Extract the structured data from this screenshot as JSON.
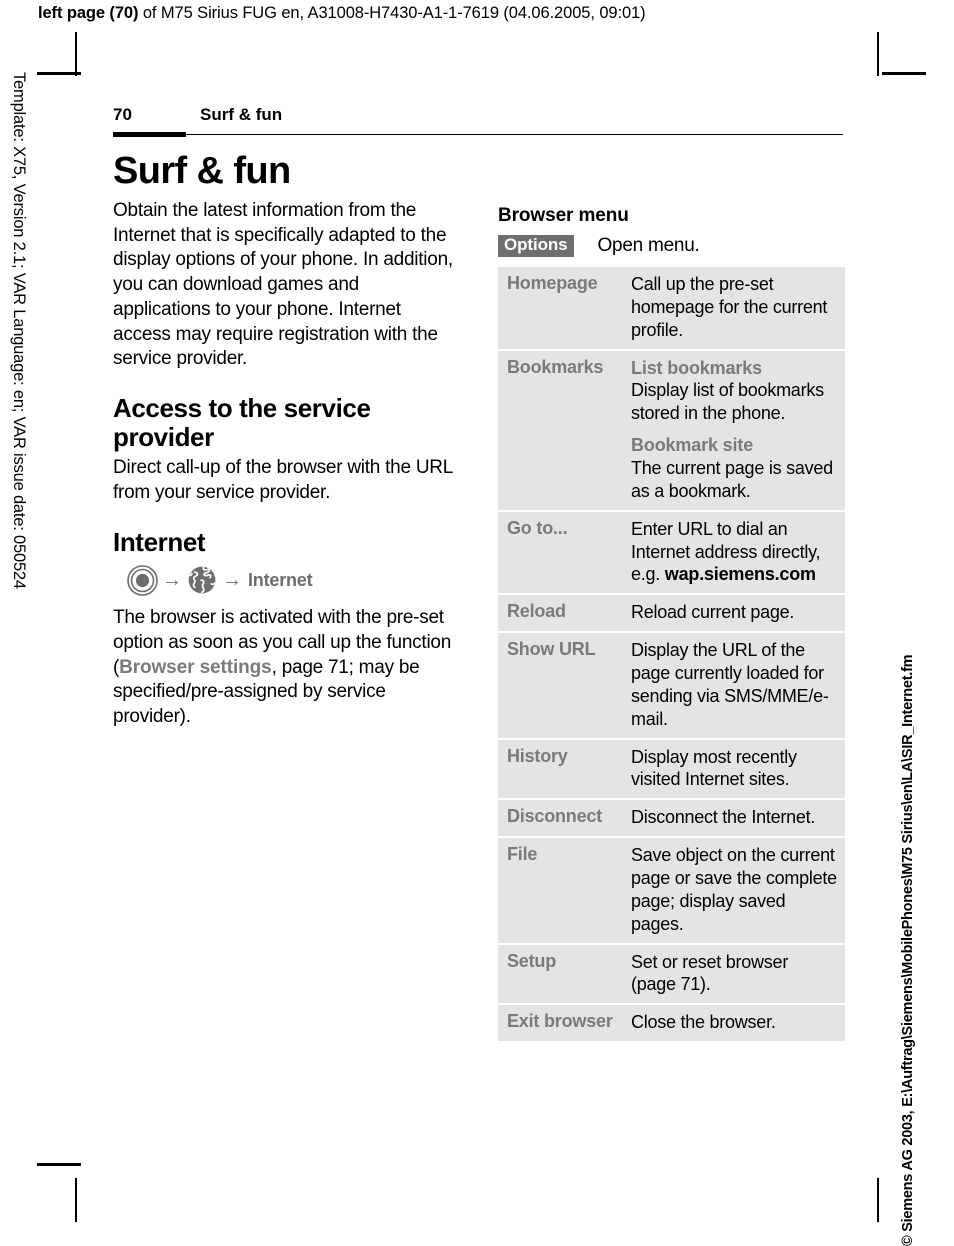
{
  "print_header": {
    "bold_prefix": "left page (70)",
    "rest": " of M75 Sirius FUG en, A31008-H7430-A1-1-7619 (04.06.2005, 09:01)"
  },
  "margins": {
    "left_text": "Template: X75, Version 2.1; VAR Language: en; VAR issue date: 050524",
    "right_text": "© Siemens AG 2003, E:\\Auftrag\\Siemens\\MobilePhones\\M75 Sirius\\en\\LA\\SIR_Internet.fm"
  },
  "running_head": {
    "page_number": "70",
    "section": "Surf & fun"
  },
  "left_column": {
    "title": "Surf & fun",
    "intro": "Obtain the latest information from the Internet that is specifically adapted to the display options of your phone. In addition, you can download games and applications to your phone. Internet access may require registration with the service provider.",
    "access_heading": "Access to the service provider",
    "access_body": "Direct call-up of the browser with the URL from your service provider.",
    "internet_heading": "Internet",
    "nav_path": {
      "arrow1": "→",
      "arrow2": "→",
      "label": "Internet"
    },
    "browser_para_1": "The browser is activated with the pre-set option as soon as you call up the function (",
    "browser_para_link": "Browser settings",
    "browser_para_2": ", page 71; may be specified/pre-assigned by service provider)."
  },
  "right_column": {
    "heading": "Browser menu",
    "options_label": "Options",
    "options_desc": "Open menu.",
    "rows": [
      {
        "label": "Homepage",
        "desc": "Call up the pre-set homepage for the current profile."
      },
      {
        "label": "Bookmarks",
        "sub": [
          {
            "head": "List bookmarks",
            "desc": "Display list of bookmarks stored in the phone."
          },
          {
            "head": "Bookmark site",
            "desc": "The current page is saved as a bookmark."
          }
        ]
      },
      {
        "label": "Go to...",
        "desc_1": "Enter URL to dial an Internet address directly, e.g. ",
        "desc_bold": "wap.siemens.com"
      },
      {
        "label": "Reload",
        "desc": "Reload current page."
      },
      {
        "label": "Show URL",
        "desc": "Display the URL of the page currently loaded for sending via SMS/MME/e-mail."
      },
      {
        "label": "History",
        "desc": "Display most recently visited Internet sites."
      },
      {
        "label": "Disconnect",
        "desc": "Disconnect the Internet."
      },
      {
        "label": "File",
        "desc": "Save object on the current page or save the complete page; display saved pages."
      },
      {
        "label": "Setup",
        "desc": "Set or reset browser (page 71)."
      },
      {
        "label": "Exit browser",
        "desc": "Close the browser."
      }
    ]
  },
  "colors": {
    "row_background": "#e4e4e4",
    "label_gray": "#7a7a7a",
    "badge_gray": "#6e6e6e"
  }
}
